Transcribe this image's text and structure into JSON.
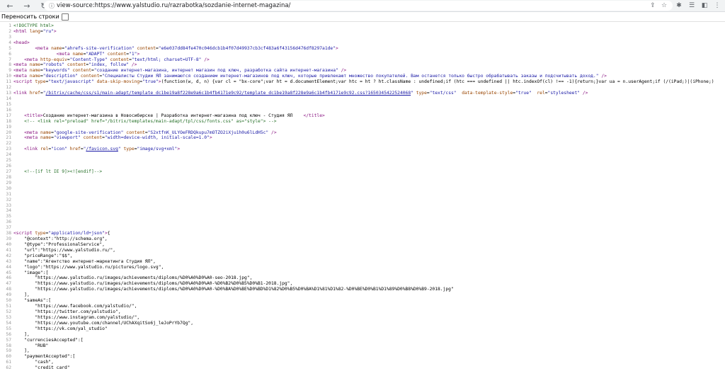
{
  "browser": {
    "back_icon": "back-arrow-icon",
    "forward_icon": "forward-arrow-icon",
    "reload_icon": "reload-icon",
    "url": "view-source:https://www.yalstudio.ru/razrabotka/sozdanie-internet-magazina/"
  },
  "toolbar": {
    "wrap_label": "Переносить строки",
    "wrap_checked": false
  },
  "source_lines": [
    {
      "n": "1",
      "html": "<span class=\"cm\">&lt;!DOCTYPE html&gt;</span>"
    },
    {
      "n": "2",
      "html": "<span class=\"tg\">&lt;html</span> <span class=\"at\">lang</span>=<span class=\"vl\">\"ru\"</span><span class=\"tg\">&gt;</span>"
    },
    {
      "n": "3",
      "html": ""
    },
    {
      "n": "4",
      "html": "<span class=\"tg\">&lt;head&gt;</span>"
    },
    {
      "n": "5",
      "html": "        <span class=\"tg\">&lt;meta</span> <span class=\"at\">name</span>=<span class=\"vl\">\"ahrefs-site-verification\"</span> <span class=\"at\">content</span>=<span class=\"vl\">\"e6e037dd84fe470c046dcb1b4f07d49937cb3cf483a6f43156d476df8297a1de\"</span><span class=\"tg\">&gt;</span>"
    },
    {
      "n": "6",
      "html": "                <span class=\"tg\">&lt;meta</span> <span class=\"at\">name</span>=<span class=\"vl\">\"ADAPT\"</span> <span class=\"at\">content</span>=<span class=\"vl\">\"1\"</span><span class=\"tg\">&gt;</span>"
    },
    {
      "n": "7",
      "html": "    <span class=\"tg\">&lt;meta</span> <span class=\"at\">http-equiv</span>=<span class=\"vl\">\"Content-Type\"</span> <span class=\"at\">content</span>=<span class=\"vl\">\"text/html; charset=UTF-8\"</span> <span class=\"tg\">/&gt;</span>"
    },
    {
      "n": "8",
      "html": "<span class=\"tg\">&lt;meta</span> <span class=\"at\">name</span>=<span class=\"vl\">\"robots\"</span> <span class=\"at\">content</span>=<span class=\"vl\">\"index, follow\"</span> <span class=\"tg\">/&gt;</span>"
    },
    {
      "n": "9",
      "html": "<span class=\"tg\">&lt;meta</span> <span class=\"at\">name</span>=<span class=\"vl\">\"keywords\"</span> <span class=\"at\">content</span>=<span class=\"vl\">\"создание интернет-магазина, интернет магазин под ключ, разработка сайта интернет-магазина\"</span> <span class=\"tg\">/&gt;</span>"
    },
    {
      "n": "10",
      "html": "<span class=\"tg\">&lt;meta</span> <span class=\"at\">name</span>=<span class=\"vl\">\"description\"</span> <span class=\"at\">content</span>=<span class=\"vl\">\"Специалисты Студии ЯЛ занимаются созданием интернет-магазинов под ключ, которые привлекают множество покупателей. Вам останется только быстро обрабатывать заказы и подсчитывать доход.\"</span> <span class=\"tg\">/&gt;</span>"
    },
    {
      "n": "11",
      "html": "<span class=\"tg\">&lt;script</span> <span class=\"at\">type</span>=<span class=\"vl\">\"text/javascript\"</span> <span class=\"at\">data-skip-moving</span>=<span class=\"vl\">\"true\"</span><span class=\"tg\">&gt;</span><span class=\"tx\">(function(w, d, n) {var cl = \"bx-core\";var ht = d.documentElement;var htc = ht ? ht.className : undefined;if (htc === undefined || htc.indexOf(cl) !== -1){return;}var ua = n.userAgent;if (/(iPad;)|(iPhone;)</span>"
    },
    {
      "n": "12",
      "html": ""
    },
    {
      "n": "13",
      "html": "<span class=\"tg\">&lt;link</span> <span class=\"at\">href</span>=<span class=\"vl\">\"</span><span class=\"lk\">/bitrix/cache/css/s1/main-adapt/template_dc1be19a8f228e9a6c1b4fb4171e9c92/template_dc1be19a8f228e9a6c1b4fb4171e9c92.css?1650345422524068</span><span class=\"vl\">\"</span> <span class=\"at\">type</span>=<span class=\"vl\">\"text/css\"</span>  <span class=\"at\">data-template-style</span>=<span class=\"vl\">\"true\"</span>  <span class=\"at\">rel</span>=<span class=\"vl\">\"stylesheet\"</span> <span class=\"tg\">/&gt;</span>"
    },
    {
      "n": "14",
      "html": ""
    },
    {
      "n": "15",
      "html": ""
    },
    {
      "n": "16",
      "html": ""
    },
    {
      "n": "17",
      "html": "    <span class=\"tg\">&lt;title&gt;</span><span class=\"tx\">Создание интернет-магазина в Новосибирске | Разработка интернет-магазина под ключ - Студия ЯЛ    </span><span class=\"tg\">&lt;/title&gt;</span>"
    },
    {
      "n": "18",
      "html": "    <span class=\"cm\">&lt;!-- &lt;link rel=\"preload\" href=\"/bitrix/templates/main-adapt/tpl/css/fonts.css\" as=\"style\"&gt; --&gt;</span>"
    },
    {
      "n": "19",
      "html": ""
    },
    {
      "n": "20",
      "html": "    <span class=\"tg\">&lt;meta</span> <span class=\"at\">name</span>=<span class=\"vl\">\"google-site-verification\"</span> <span class=\"at\">content</span>=<span class=\"vl\">\"S2xtfnK_ULYOeFRDQkupu7mOTZO2iXju1h0u6lLdH5c\"</span> <span class=\"tg\">/&gt;</span>"
    },
    {
      "n": "21",
      "html": "    <span class=\"tg\">&lt;meta</span> <span class=\"at\">name</span>=<span class=\"vl\">\"viewport\"</span> <span class=\"at\">content</span>=<span class=\"vl\">\"width=device-width, initial-scale=1.0\"</span><span class=\"tg\">&gt;</span>"
    },
    {
      "n": "22",
      "html": ""
    },
    {
      "n": "23",
      "html": "    <span class=\"tg\">&lt;link</span> <span class=\"at\">rel</span>=<span class=\"vl\">\"icon\"</span> <span class=\"at\">href</span>=<span class=\"vl\">\"</span><span class=\"lk\">/favicon.svg</span><span class=\"vl\">\"</span> <span class=\"at\">type</span>=<span class=\"vl\">\"image/svg+xml\"</span><span class=\"tg\">&gt;</span>"
    },
    {
      "n": "24",
      "html": ""
    },
    {
      "n": "25",
      "html": ""
    },
    {
      "n": "26",
      "html": ""
    },
    {
      "n": "27",
      "html": "    <span class=\"cm\">&lt;!--[if lt IE 9]&gt;&lt;![endif]--&gt;</span>"
    },
    {
      "n": "28",
      "html": ""
    },
    {
      "n": "29",
      "html": ""
    },
    {
      "n": "30",
      "html": ""
    },
    {
      "n": "31",
      "html": ""
    },
    {
      "n": "32",
      "html": ""
    },
    {
      "n": "33",
      "html": ""
    },
    {
      "n": "34",
      "html": ""
    },
    {
      "n": "35",
      "html": ""
    },
    {
      "n": "36",
      "html": ""
    },
    {
      "n": "37",
      "html": ""
    },
    {
      "n": "38",
      "html": "<span class=\"tg\">&lt;script</span> <span class=\"at\">type</span>=<span class=\"vl\">\"application/ld+json\"</span><span class=\"tg\">&gt;</span><span class=\"tx\">{</span>"
    },
    {
      "n": "39",
      "html": "<span class=\"tx\">    \"@context\":\"http://schema.org\",</span>"
    },
    {
      "n": "40",
      "html": "<span class=\"tx\">    \"@type\":\"ProfessionalService\",</span>"
    },
    {
      "n": "41",
      "html": "<span class=\"tx\">    \"url\":\"https://www.yalstudio.ru/\",</span>"
    },
    {
      "n": "42",
      "html": "<span class=\"tx\">    \"priceRange\":\"$$\",</span>"
    },
    {
      "n": "43",
      "html": "<span class=\"tx\">    \"name\":\"Агентство интернет-маркетинга Студия ЯЛ\",</span>"
    },
    {
      "n": "44",
      "html": "<span class=\"tx\">    \"logo\":\"https://www.yalstudio.ru/pictures/logo.svg\",</span>"
    },
    {
      "n": "45",
      "html": "<span class=\"tx\">    \"image\":[</span>"
    },
    {
      "n": "46",
      "html": "<span class=\"tx\">        \"https://www.yalstudio.ru/images/achievements/diploms/%D0%A0%D0%A0-seo-2018.jpg\",</span>"
    },
    {
      "n": "47",
      "html": "<span class=\"tx\">        \"https://www.yalstudio.ru/images/achievements/diploms/%D0%A0%D0%A0-%D0%B2%D0%B5%D0%B1-2018.jpg\",</span>"
    },
    {
      "n": "48",
      "html": "<span class=\"tx\">        \"https://www.yalstudio.ru/images/achievements/diploms/%D0%A0%D0%A0-%D0%BA%D0%BE%D0%BD%D1%82%D0%B5%D0%BA%D1%81%D1%82-%D0%BE%D0%B1%D1%89%D0%B8%D0%B9-2018.jpg\"</span>"
    },
    {
      "n": "49",
      "html": "<span class=\"tx\">    ],</span>"
    },
    {
      "n": "50",
      "html": "<span class=\"tx\">    \"sameAs\":[</span>"
    },
    {
      "n": "51",
      "html": "<span class=\"tx\">        \"https://www.facebook.com/yalstudio/\",</span>"
    },
    {
      "n": "52",
      "html": "<span class=\"tx\">        \"https://twitter.com/yalstudio\",</span>"
    },
    {
      "n": "53",
      "html": "<span class=\"tx\">        \"https://www.instagram.com/yalstudio/\",</span>"
    },
    {
      "n": "54",
      "html": "<span class=\"tx\">        \"https://www.youtube.com/channel/UChAXqitSo6j_leJoPrYb7Qg\",</span>"
    },
    {
      "n": "55",
      "html": "<span class=\"tx\">        \"https://vk.com/yal_studio\"</span>"
    },
    {
      "n": "56",
      "html": "<span class=\"tx\">    ],</span>"
    },
    {
      "n": "57",
      "html": "<span class=\"tx\">    \"currenciesAccepted\":[</span>"
    },
    {
      "n": "58",
      "html": "<span class=\"tx\">        \"RUB\"</span>"
    },
    {
      "n": "59",
      "html": "<span class=\"tx\">    ],</span>"
    },
    {
      "n": "60",
      "html": "<span class=\"tx\">    \"paymentAccepted\":[</span>"
    },
    {
      "n": "61",
      "html": "<span class=\"tx\">        \"cash\",</span>"
    },
    {
      "n": "62",
      "html": "<span class=\"tx\">        \"credit card\"</span>"
    }
  ]
}
